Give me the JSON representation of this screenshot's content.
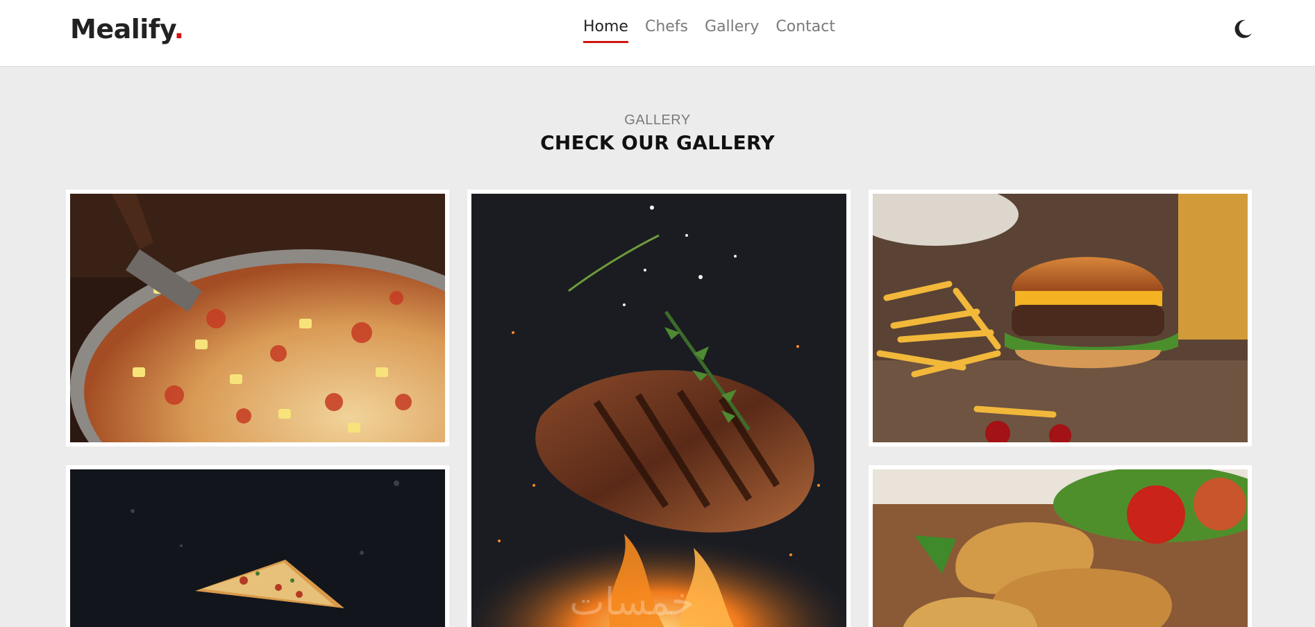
{
  "brand": {
    "name": "Mealify",
    "dot": ".",
    "accent_color": "#d0140d"
  },
  "nav": {
    "items": [
      {
        "label": "Home",
        "active": true
      },
      {
        "label": "Chefs",
        "active": false
      },
      {
        "label": "Gallery",
        "active": false
      },
      {
        "label": "Contact",
        "active": false
      }
    ],
    "theme_toggle_icon": "moon-icon"
  },
  "gallery": {
    "eyebrow": "GALLERY",
    "title": "CHECK OUR GALLERY",
    "images": [
      {
        "name": "pizza-slice"
      },
      {
        "name": "grilled-steak"
      },
      {
        "name": "burger-fries"
      },
      {
        "name": "flying-pizza"
      },
      {
        "name": "fried-chicken"
      }
    ]
  },
  "watermark": "خمسات"
}
